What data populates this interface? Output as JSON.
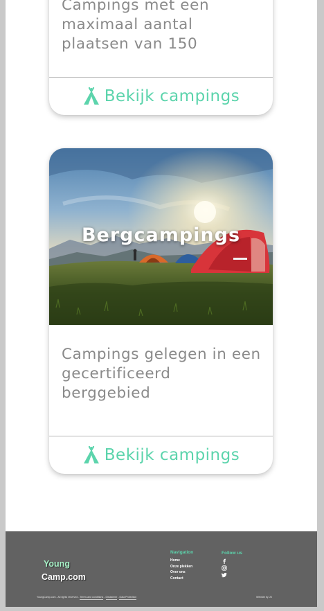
{
  "cards": [
    {
      "description": "Campings met een maximaal aantal plaatsen van 150",
      "button_label": "Bekijk campings"
    },
    {
      "title": "Bergcampings",
      "description": "Campings gelegen in een gecertificeerd berggebied",
      "button_label": "Bekijk campings"
    }
  ],
  "footer": {
    "logo": {
      "part1": "Young",
      "part2": "Camp.com"
    },
    "navigation": {
      "title": "Navigation",
      "links": [
        "Home",
        "Onze plekken",
        "Over ons",
        "Contact"
      ]
    },
    "follow": {
      "title": "Follow us",
      "icons": [
        "facebook-icon",
        "instagram-icon",
        "twitter-icon"
      ]
    },
    "copyright": "YoungCamp.com - All rights reserved -",
    "legal_links": [
      "Terms and conditions",
      "Disclaimer",
      "Data Protection"
    ],
    "credit": "Website by JS"
  },
  "colors": {
    "accent": "#5cd4ac",
    "footer_bg": "#626262",
    "text_muted": "#8a8a8a",
    "page_bg": "#c9c9c9"
  }
}
